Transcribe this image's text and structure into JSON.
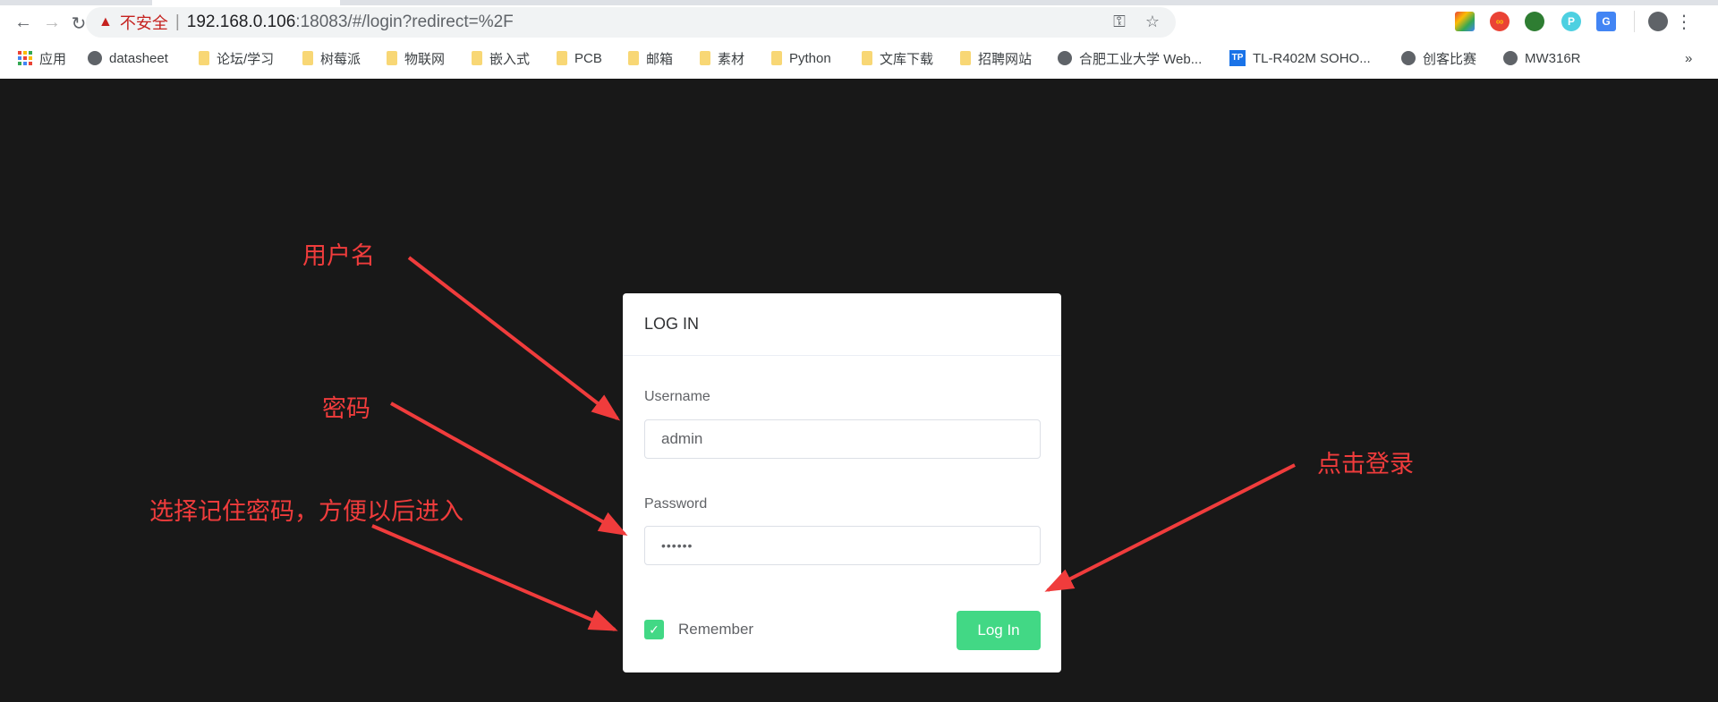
{
  "browser": {
    "security_label": "不安全",
    "url_host": "192.168.0.106",
    "url_rest": ":18083/#/login?redirect=%2F",
    "bookmarks": [
      {
        "label": "应用",
        "icon": "apps-icon"
      },
      {
        "label": "datasheet",
        "icon": "globe-icon"
      },
      {
        "label": "论坛/学习",
        "icon": "folder-icon"
      },
      {
        "label": "树莓派",
        "icon": "folder-icon"
      },
      {
        "label": "物联网",
        "icon": "folder-icon"
      },
      {
        "label": "嵌入式",
        "icon": "folder-icon"
      },
      {
        "label": "PCB",
        "icon": "folder-icon"
      },
      {
        "label": "邮箱",
        "icon": "folder-icon"
      },
      {
        "label": "素材",
        "icon": "folder-icon"
      },
      {
        "label": "Python",
        "icon": "folder-icon"
      },
      {
        "label": "文库下载",
        "icon": "folder-icon"
      },
      {
        "label": "招聘网站",
        "icon": "folder-icon"
      },
      {
        "label": "合肥工业大学 Web...",
        "icon": "globe-icon"
      },
      {
        "label": "TL-R402M SOHO...",
        "icon": "tp-icon"
      },
      {
        "label": "创客比赛",
        "icon": "globe-icon"
      },
      {
        "label": "MW316R",
        "icon": "globe-icon"
      }
    ],
    "overflow": "»",
    "ext_p": "P",
    "ext_tp": "TP"
  },
  "login": {
    "title": "LOG IN",
    "username_label": "Username",
    "username_value": "admin",
    "password_label": "Password",
    "password_value": "••••••",
    "remember_label": "Remember",
    "remember_checked": true,
    "submit_label": "Log In",
    "accent": "#42d885"
  },
  "annotations": {
    "username": "用户名",
    "password": "密码",
    "remember": "选择记住密码，方便以后进入",
    "login": "点击登录",
    "color": "#f03c3c"
  }
}
